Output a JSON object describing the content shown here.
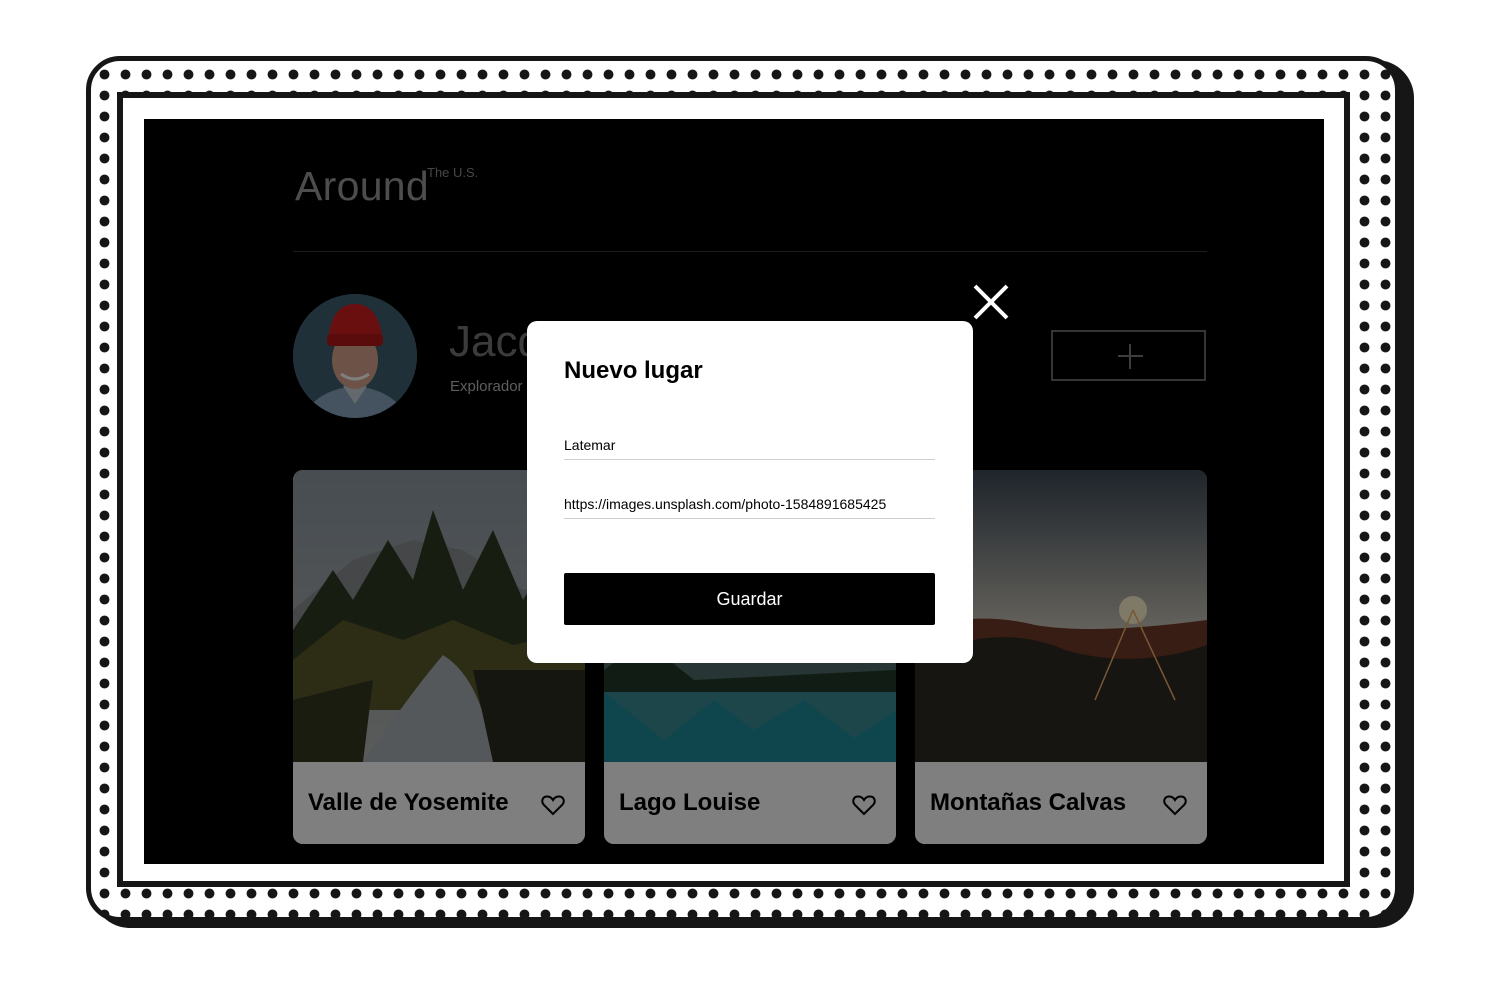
{
  "header": {
    "logo": "Around",
    "logo_superscript": "The U.S."
  },
  "profile": {
    "name": "Jacques Cousteau",
    "about": "Explorador"
  },
  "add_button": {
    "icon": "plus-icon"
  },
  "cards": [
    {
      "title": "Valle de Yosemite",
      "icon": "heart-icon"
    },
    {
      "title": "Lago Louise",
      "icon": "heart-icon"
    },
    {
      "title": "Montañas Calvas",
      "icon": "heart-icon"
    }
  ],
  "modal": {
    "title": "Nuevo lugar",
    "name_value": "Latemar",
    "link_value": "https://images.unsplash.com/photo-1584891685425",
    "save_label": "Guardar",
    "close_icon": "close-icon"
  }
}
